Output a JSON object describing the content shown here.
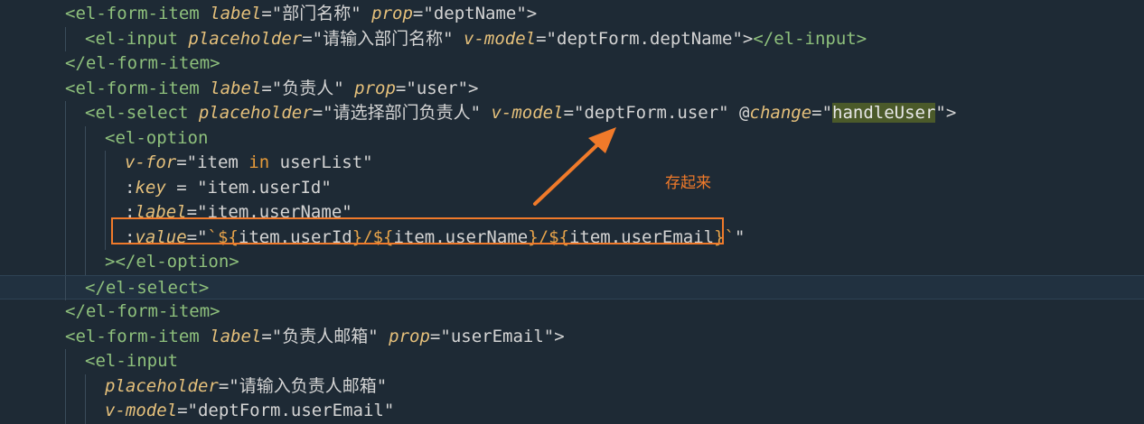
{
  "lines": [
    {
      "indent": 1,
      "tokens": [
        [
          "tag",
          "<el-form-item "
        ],
        [
          "attr",
          "label"
        ],
        [
          "punct",
          "=\""
        ],
        [
          "str",
          "部门名称"
        ],
        [
          "punct",
          "\" "
        ],
        [
          "attr",
          "prop"
        ],
        [
          "punct",
          "=\""
        ],
        [
          "str",
          "deptName"
        ],
        [
          "punct",
          "\">"
        ]
      ]
    },
    {
      "indent": 2,
      "tokens": [
        [
          "tag",
          "<el-input "
        ],
        [
          "attr",
          "placeholder"
        ],
        [
          "punct",
          "=\""
        ],
        [
          "str",
          "请输入部门名称"
        ],
        [
          "punct",
          "\" "
        ],
        [
          "attr",
          "v-model"
        ],
        [
          "punct",
          "=\""
        ],
        [
          "str",
          "deptForm.deptName"
        ],
        [
          "punct",
          "\">"
        ],
        [
          "tag",
          "</el-input>"
        ]
      ]
    },
    {
      "indent": 1,
      "tokens": [
        [
          "tag",
          "</el-form-item>"
        ]
      ]
    },
    {
      "indent": 1,
      "tokens": [
        [
          "tag",
          "<el-form-item "
        ],
        [
          "attr",
          "label"
        ],
        [
          "punct",
          "=\""
        ],
        [
          "str",
          "负责人"
        ],
        [
          "punct",
          "\" "
        ],
        [
          "attr",
          "prop"
        ],
        [
          "punct",
          "=\""
        ],
        [
          "str",
          "user"
        ],
        [
          "punct",
          "\">"
        ]
      ]
    },
    {
      "indent": 2,
      "tokens": [
        [
          "tag",
          "<el-select "
        ],
        [
          "attr",
          "placeholder"
        ],
        [
          "punct",
          "=\""
        ],
        [
          "str",
          "请选择部门负责人"
        ],
        [
          "punct",
          "\" "
        ],
        [
          "attr",
          "v-model"
        ],
        [
          "punct",
          "=\""
        ],
        [
          "str",
          "deptForm.user"
        ],
        [
          "punct",
          "\" @"
        ],
        [
          "attr",
          "change"
        ],
        [
          "punct",
          "=\""
        ],
        [
          "hl",
          "handleUser"
        ],
        [
          "punct",
          "\">"
        ]
      ]
    },
    {
      "indent": 3,
      "tokens": [
        [
          "tag",
          "<el-option"
        ]
      ]
    },
    {
      "indent": 4,
      "tokens": [
        [
          "attr",
          "v-for"
        ],
        [
          "punct",
          "=\""
        ],
        [
          "str",
          "item "
        ],
        [
          "kw",
          "in"
        ],
        [
          "str",
          " userList"
        ],
        [
          "punct",
          "\""
        ]
      ]
    },
    {
      "indent": 4,
      "tokens": [
        [
          "punct",
          ":"
        ],
        [
          "attr",
          "key"
        ],
        [
          "punct",
          " = \""
        ],
        [
          "str",
          "item.userId"
        ],
        [
          "punct",
          "\""
        ]
      ]
    },
    {
      "indent": 4,
      "tokens": [
        [
          "punct",
          ":"
        ],
        [
          "attr",
          "label"
        ],
        [
          "punct",
          "=\""
        ],
        [
          "str",
          "item.userName"
        ],
        [
          "punct",
          "\""
        ]
      ]
    },
    {
      "indent": 4,
      "tokens": [
        [
          "punct",
          ":"
        ],
        [
          "attr",
          "value"
        ],
        [
          "punct",
          "=\""
        ],
        [
          "tmpl",
          "`${"
        ],
        [
          "str",
          "item.userId"
        ],
        [
          "tmpl",
          "}/${"
        ],
        [
          "str",
          "item.userName"
        ],
        [
          "tmpl",
          "}/${"
        ],
        [
          "str",
          "item.userEmail"
        ],
        [
          "tmpl",
          "}`"
        ],
        [
          "punct",
          "\""
        ]
      ]
    },
    {
      "indent": 3,
      "tokens": [
        [
          "tag",
          "></el-option>"
        ]
      ]
    },
    {
      "indent": 2,
      "tokens": [
        [
          "tag",
          "</el-select>"
        ]
      ],
      "current": true
    },
    {
      "indent": 1,
      "tokens": [
        [
          "tag",
          "</el-form-item>"
        ]
      ]
    },
    {
      "indent": 1,
      "tokens": [
        [
          "tag",
          "<el-form-item "
        ],
        [
          "attr",
          "label"
        ],
        [
          "punct",
          "=\""
        ],
        [
          "str",
          "负责人邮箱"
        ],
        [
          "punct",
          "\" "
        ],
        [
          "attr",
          "prop"
        ],
        [
          "punct",
          "=\""
        ],
        [
          "str",
          "userEmail"
        ],
        [
          "punct",
          "\">"
        ]
      ]
    },
    {
      "indent": 2,
      "tokens": [
        [
          "tag",
          "<el-input"
        ]
      ]
    },
    {
      "indent": 3,
      "tokens": [
        [
          "attr",
          "placeholder"
        ],
        [
          "punct",
          "=\""
        ],
        [
          "str",
          "请输入负责人邮箱"
        ],
        [
          "punct",
          "\""
        ]
      ]
    },
    {
      "indent": 3,
      "tokens": [
        [
          "attr",
          "v-model"
        ],
        [
          "punct",
          "=\""
        ],
        [
          "str",
          "deptForm.userEmail"
        ],
        [
          "punct",
          "\""
        ]
      ]
    }
  ],
  "annotation": {
    "text": "存起来",
    "color": "#f07a2a"
  },
  "colors": {
    "background": "#1e2a35",
    "tag": "#8ec07c",
    "attr": "#e5c07b",
    "keyword": "#e59a3a",
    "accent": "#f07a2a"
  }
}
